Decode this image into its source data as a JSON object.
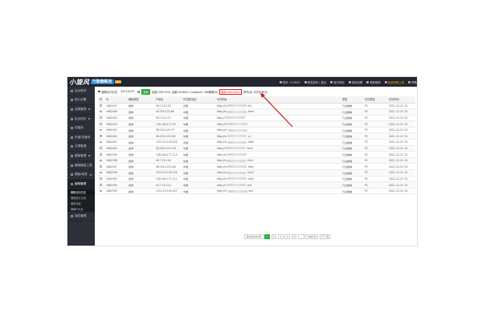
{
  "header": {
    "logo_text": "小旋风",
    "logo_sub": "万能蜘蛛池",
    "logo_badge": "v8.5",
    "nav": [
      {
        "label": "您好: 147603",
        "icon": "user-icon",
        "highlight": false
      },
      {
        "label": "修改密码 | 退出",
        "icon": "lock-icon",
        "highlight": false
      },
      {
        "label": "官方网站",
        "icon": "globe-icon",
        "highlight": false
      },
      {
        "label": "系统设置",
        "icon": "gear-icon",
        "highlight": false
      },
      {
        "label": "更新程序",
        "icon": "refresh-icon",
        "highlight": false
      },
      {
        "label": "免费获取工具",
        "icon": "gift-icon",
        "highlight": true
      },
      {
        "label": "帮助",
        "icon": "help-icon",
        "highlight": false
      }
    ]
  },
  "sidebar": {
    "items": [
      {
        "label": "后台首页",
        "flag": false
      },
      {
        "label": "核心设置",
        "flag": false
      },
      {
        "label": "站群管理",
        "flag": true
      },
      {
        "label": "站点优化",
        "flag": true
      },
      {
        "label": "内链池",
        "flag": false
      },
      {
        "label": "外链/关键词",
        "flag": false
      },
      {
        "label": "文章管理",
        "flag": false
      },
      {
        "label": "模板管理",
        "flag": true
      },
      {
        "label": "蜘蛛增量工具",
        "flag": true
      },
      {
        "label": "模板/标签",
        "flag": true
      },
      {
        "label": "蜘蛛管理",
        "flag": false,
        "active": true
      }
    ],
    "subitems": [
      {
        "label": "蜘蛛访问日志",
        "active": true
      },
      {
        "label": "蜘蛛统计记录",
        "active": false
      },
      {
        "label": "蜘蛛设置",
        "active": false
      },
      {
        "label": "蜘蛛IP大全",
        "active": false
      }
    ],
    "footer_item": {
      "label": "插件管理"
    }
  },
  "filter": {
    "label": "蜘蛛访问日志",
    "date": "2021/2/23",
    "query_button": "查询",
    "stats_prefix": "全部(1997414) 百度(315607) Google(0) 360蜘蛛(0)",
    "stats_highlight": "搜狗(1642407)",
    "stats_suffix": "神马(0) 今日头条(0)"
  },
  "table": {
    "columns": [
      "ID",
      "蜘蛛类型",
      "IP地址",
      "IP归属/地区",
      "访问网址",
      "",
      "类型",
      "访问类型",
      "访问时间"
    ],
    "rows": [
      {
        "id": "1662407",
        "type": "搜狗",
        "ip": "49.7.20.118",
        "region": "中国",
        "url_start": "http://ni",
        "url_end": "/m/",
        "kind": "行业蜘蛛",
        "device": "PC",
        "time": "2021-12-22 15:"
      },
      {
        "id": "1662406",
        "type": "搜狗",
        "ip": "58.250.125.66",
        "region": "中国",
        "url_start": "http://w",
        "url_end": ".html",
        "kind": "行业蜘蛛",
        "device": "PC",
        "time": "2021-12-22 15:"
      },
      {
        "id": "1662405",
        "type": "搜狗",
        "ip": "49.7.20.113",
        "region": "中国",
        "url_start": "http://l",
        "url_end": "",
        "kind": "行业蜘蛛",
        "device": "PC",
        "time": "2021-12-22 15:"
      },
      {
        "id": "1662404",
        "type": "搜狗",
        "ip": "118.184.177.43",
        "region": "中国",
        "url_start": "http://91",
        "url_end": "",
        "kind": "行业蜘蛛",
        "device": "PC",
        "time": "2021-12-22 15:"
      },
      {
        "id": "1662403",
        "type": "搜狗",
        "ip": "58.250.125.79",
        "region": "中国",
        "url_start": "http://cc",
        "url_end": "",
        "kind": "行业蜘蛛",
        "device": "PC",
        "time": "2021-12-22 15:"
      },
      {
        "id": "1662402",
        "type": "搜狗",
        "ip": "58.250.125.180",
        "region": "中国",
        "url_start": "http://w",
        "url_end": ".cc",
        "kind": "行业蜘蛛",
        "device": "PC",
        "time": "2021-12-22 15:"
      },
      {
        "id": "1662401",
        "type": "搜狗",
        "ip": "123.125.109.205",
        "region": "中国",
        "url_start": "http://w",
        "url_end": ".html",
        "kind": "行业蜘蛛",
        "device": "PC",
        "time": "2021-12-22 15:"
      },
      {
        "id": "1662400",
        "type": "搜狗",
        "ip": "58.250.125.178",
        "region": "中国",
        "url_start": "http://l",
        "url_end": ".html",
        "kind": "行业蜘蛛",
        "device": "PC",
        "time": "2021-12-22 15:"
      },
      {
        "id": "1662399",
        "type": "搜狗",
        "ip": "118.184.177.113",
        "region": "中国",
        "url_start": "http://w",
        "url_end": "",
        "kind": "行业蜘蛛",
        "device": "PC",
        "time": "2021-12-22 15:"
      },
      {
        "id": "1662398",
        "type": "搜狗",
        "ip": "49.7.20.154",
        "region": "中国",
        "url_start": "http://a",
        "url_end": ".html",
        "kind": "行业蜘蛛",
        "device": "PC",
        "time": "2021-12-22 15:"
      },
      {
        "id": "1662397",
        "type": "搜狗",
        "ip": "58.250.125.108",
        "region": "中国",
        "url_start": "http://w",
        "url_end": ".html",
        "kind": "行业蜘蛛",
        "device": "PC",
        "time": "2021-12-22 15:"
      },
      {
        "id": "1662396",
        "type": "搜狗",
        "ip": "123.125.109.146",
        "region": "中国",
        "url_start": "http://p",
        "url_end": ".html",
        "kind": "行业蜘蛛",
        "device": "PC",
        "time": "2021-12-22 15:"
      },
      {
        "id": "1662395",
        "type": "搜狗",
        "ip": "118.184.177.111",
        "region": "中国",
        "url_start": "http://w",
        "url_end": ".html",
        "kind": "行业蜘蛛",
        "device": "PC",
        "time": "2021-12-22 15:"
      },
      {
        "id": "1662394",
        "type": "搜狗",
        "ip": "49.7.20.112",
        "region": "中国",
        "url_start": "http://t",
        "url_end": ".xml",
        "kind": "行业蜘蛛",
        "device": "PC",
        "time": "2021-12-22 15:"
      },
      {
        "id": "1662393",
        "type": "搜狗",
        "ip": "123.125.109.207",
        "region": "中国",
        "url_start": "http://m",
        "url_end": ".xml",
        "kind": "行业蜘蛛",
        "device": "PC",
        "time": "2021-12-22 15:"
      }
    ]
  },
  "pager": {
    "summary": "共1662407条",
    "pages": [
      "1",
      "2",
      "3",
      "4",
      "5"
    ],
    "current": "1",
    "dots": "…",
    "last": "166241",
    "next": "下一页"
  },
  "colors": {
    "topbar": "#23262e",
    "sidebar": "#2c3038",
    "accent_green": "#2eaa3c",
    "highlight_red": "#e02020",
    "time_red": "#e03030"
  }
}
